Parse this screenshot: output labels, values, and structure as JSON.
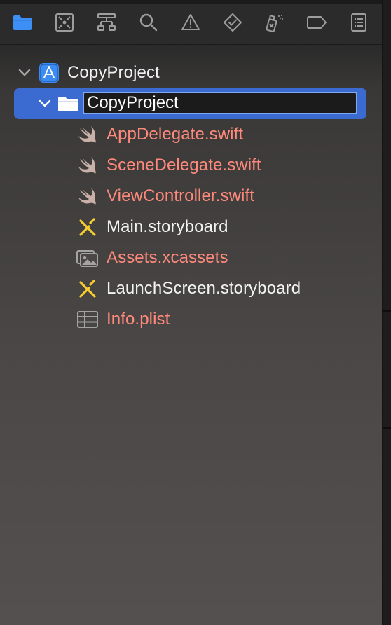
{
  "navigator": {
    "toolbar": [
      {
        "name": "project-navigator",
        "icon": "folder-icon",
        "active": true
      },
      {
        "name": "source-control-navigator",
        "icon": "source-control-icon",
        "active": false
      },
      {
        "name": "symbol-navigator",
        "icon": "hierarchy-icon",
        "active": false
      },
      {
        "name": "find-navigator",
        "icon": "search-icon",
        "active": false
      },
      {
        "name": "issue-navigator",
        "icon": "warning-icon",
        "active": false
      },
      {
        "name": "test-navigator",
        "icon": "diamond-check-icon",
        "active": false
      },
      {
        "name": "debug-navigator",
        "icon": "spray-can-icon",
        "active": false
      },
      {
        "name": "breakpoint-navigator",
        "icon": "breakpoint-tag-icon",
        "active": false
      },
      {
        "name": "report-navigator",
        "icon": "report-list-icon",
        "active": false
      }
    ],
    "project": {
      "name": "CopyProject",
      "icon": "xcode-project-icon",
      "expanded": true
    },
    "group": {
      "name": "CopyProject",
      "icon": "folder-icon",
      "expanded": true,
      "selected": true,
      "editing": true
    },
    "files": [
      {
        "name": "AppDelegate.swift",
        "icon": "swift-icon",
        "missing": true
      },
      {
        "name": "SceneDelegate.swift",
        "icon": "swift-icon",
        "missing": true
      },
      {
        "name": "ViewController.swift",
        "icon": "swift-icon",
        "missing": true
      },
      {
        "name": "Main.storyboard",
        "icon": "storyboard-icon",
        "missing": false
      },
      {
        "name": "Assets.xcassets",
        "icon": "asset-catalog-icon",
        "missing": true
      },
      {
        "name": "LaunchScreen.storyboard",
        "icon": "storyboard-icon",
        "missing": false
      },
      {
        "name": "Info.plist",
        "icon": "plist-table-icon",
        "missing": true
      }
    ]
  },
  "colors": {
    "accent": "#3b6ad0",
    "missing_file_text": "#ff8a7c",
    "normal_text": "#f2f2f2",
    "storyboard_icon": "#f7cd2f",
    "swift_icon": "#c9b0a8"
  }
}
